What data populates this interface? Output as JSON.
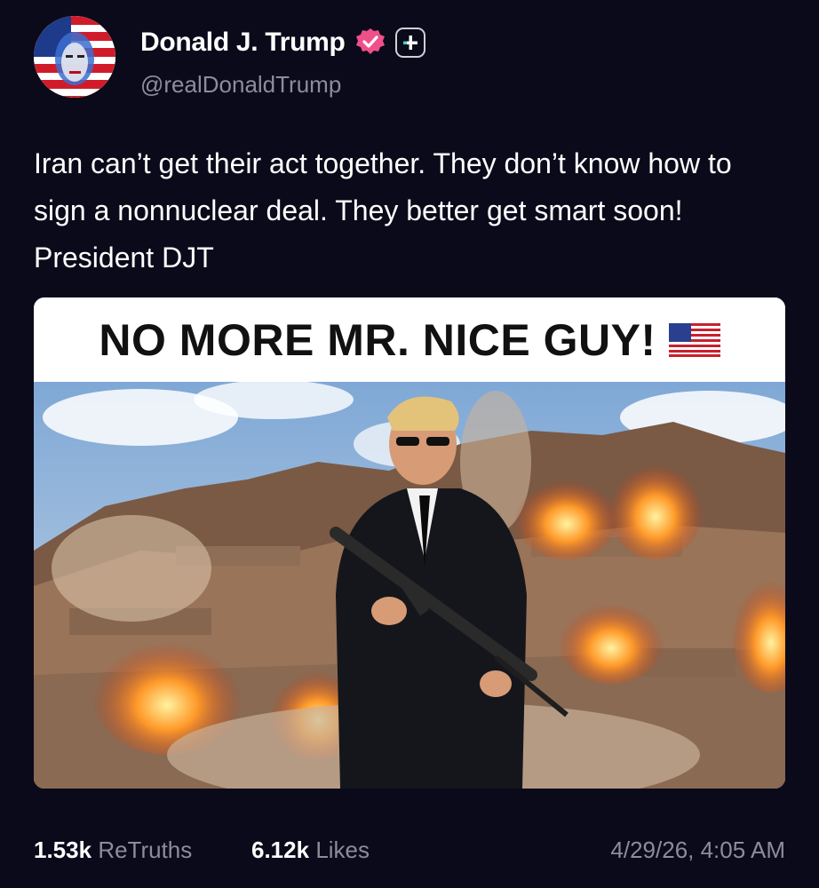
{
  "account": {
    "display_name": "Donald J. Trump",
    "handle": "@realDonaldTrump",
    "avatar_icon": "flag-portrait-avatar",
    "verified_icon": "verified-badge-icon",
    "verified_color": "#f0508a",
    "plus_icon": "plus-badge-icon"
  },
  "post": {
    "text": "Iran can’t get their act together. They don’t know how to sign a nonnuclear deal. They better get smart soon! President DJT"
  },
  "media": {
    "banner_text": "NO MORE MR. NICE GUY!",
    "banner_icon": "us-flag-icon"
  },
  "stats": {
    "retruths_count": "1.53k",
    "retruths_label": "ReTruths",
    "likes_count": "6.12k",
    "likes_label": "Likes",
    "timestamp": "4/29/26, 4:05 AM"
  },
  "colors": {
    "background": "#0a0a1a",
    "secondary_text": "#8c8c9a"
  }
}
